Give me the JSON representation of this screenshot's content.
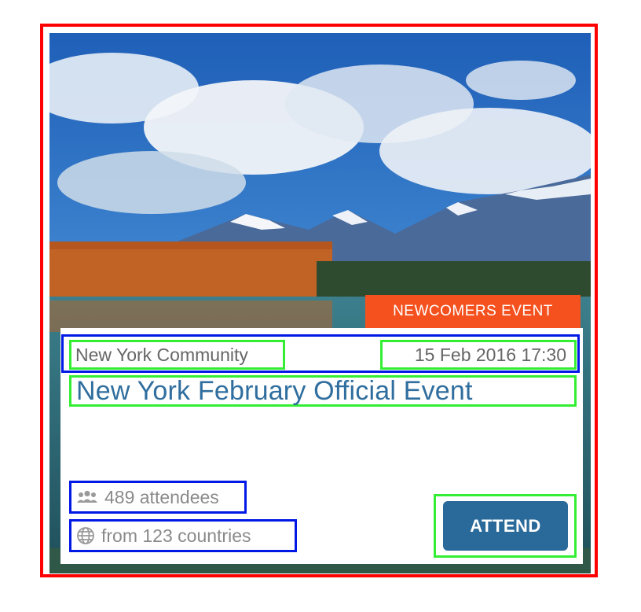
{
  "colors": {
    "annotation_outer": "#ff0000",
    "annotation_group": "#0018e6",
    "annotation_item": "#33ee33",
    "badge": "#f4511e",
    "title": "#2f6e9e",
    "button": "#2a6a9a"
  },
  "event_card": {
    "badge": "NEWCOMERS EVENT",
    "community": "New York Community",
    "datetime": "15 Feb 2016 17:30",
    "title": "New York February Official Event",
    "attendees_text": "489 attendees",
    "attendees_icon": "group-icon",
    "countries_text": "from 123 countries",
    "countries_icon": "globe-icon",
    "attend_label": "ATTEND"
  }
}
